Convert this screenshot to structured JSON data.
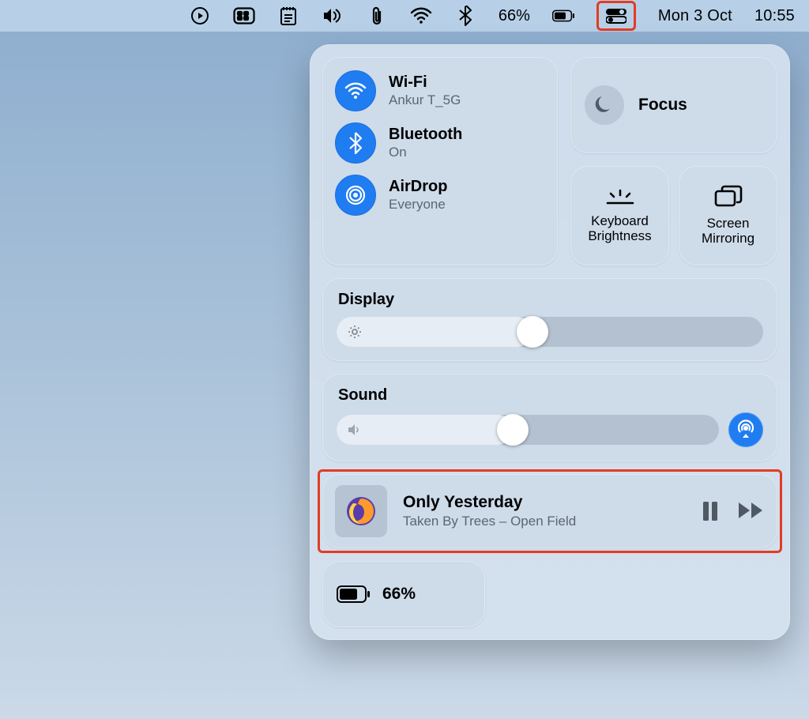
{
  "menubar": {
    "battery_percent": "66%",
    "date": "Mon 3 Oct",
    "time": "10:55"
  },
  "connectivity": {
    "wifi": {
      "title": "Wi-Fi",
      "sub": "Ankur T_5G"
    },
    "bluetooth": {
      "title": "Bluetooth",
      "sub": "On"
    },
    "airdrop": {
      "title": "AirDrop",
      "sub": "Everyone"
    }
  },
  "focus": {
    "label": "Focus"
  },
  "small_cards": {
    "keyboard": "Keyboard Brightness",
    "mirror": "Screen Mirroring"
  },
  "display": {
    "label": "Display",
    "value_percent": 42
  },
  "sound": {
    "label": "Sound",
    "value_percent": 42
  },
  "media": {
    "title": "Only Yesterday",
    "subtitle": "Taken By Trees – Open Field"
  },
  "battery": {
    "label": "66%"
  }
}
